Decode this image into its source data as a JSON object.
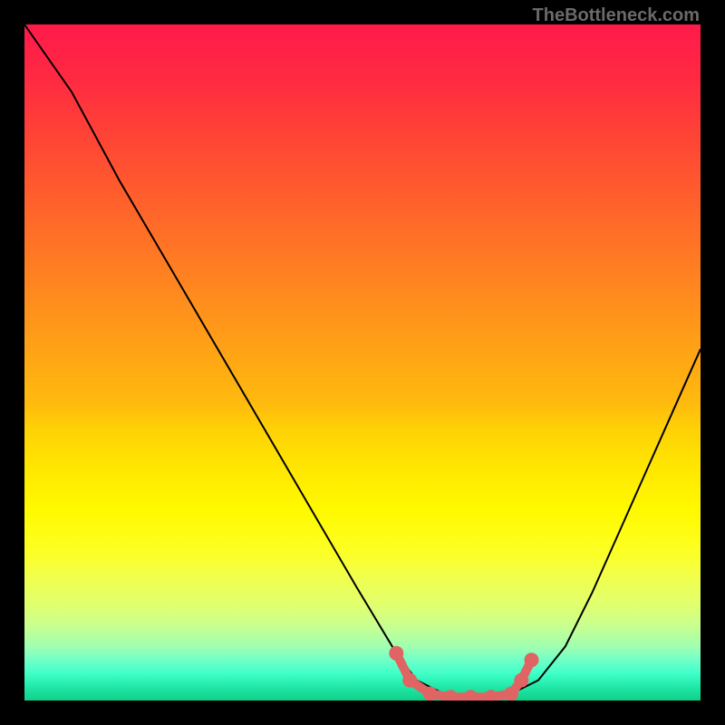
{
  "watermark": "TheBottleneck.com",
  "chart_data": {
    "type": "line",
    "title": "",
    "xlabel": "",
    "ylabel": "",
    "xlim": [
      0,
      100
    ],
    "ylim": [
      0,
      100
    ],
    "series": [
      {
        "name": "bottleneck-curve",
        "x": [
          0,
          7,
          14,
          21,
          28,
          35,
          42,
          49,
          55,
          58,
          62,
          66,
          70,
          72,
          76,
          80,
          84,
          88,
          92,
          96,
          100
        ],
        "values": [
          100,
          90,
          77,
          65,
          53,
          41,
          29,
          17,
          7,
          3,
          1,
          0.5,
          0.5,
          1,
          3,
          8,
          16,
          25,
          34,
          43,
          52
        ]
      }
    ],
    "markers": {
      "name": "highlight-segment",
      "color": "#e06464",
      "points": [
        {
          "x": 55,
          "y": 7
        },
        {
          "x": 57,
          "y": 3
        },
        {
          "x": 60,
          "y": 1
        },
        {
          "x": 63,
          "y": 0.5
        },
        {
          "x": 66,
          "y": 0.5
        },
        {
          "x": 69,
          "y": 0.5
        },
        {
          "x": 72,
          "y": 1
        },
        {
          "x": 73.5,
          "y": 3
        },
        {
          "x": 75,
          "y": 6
        }
      ]
    },
    "background": {
      "type": "vertical-gradient",
      "stops": [
        "#ff1a4a",
        "#ffd800",
        "#20e8a8"
      ]
    }
  }
}
